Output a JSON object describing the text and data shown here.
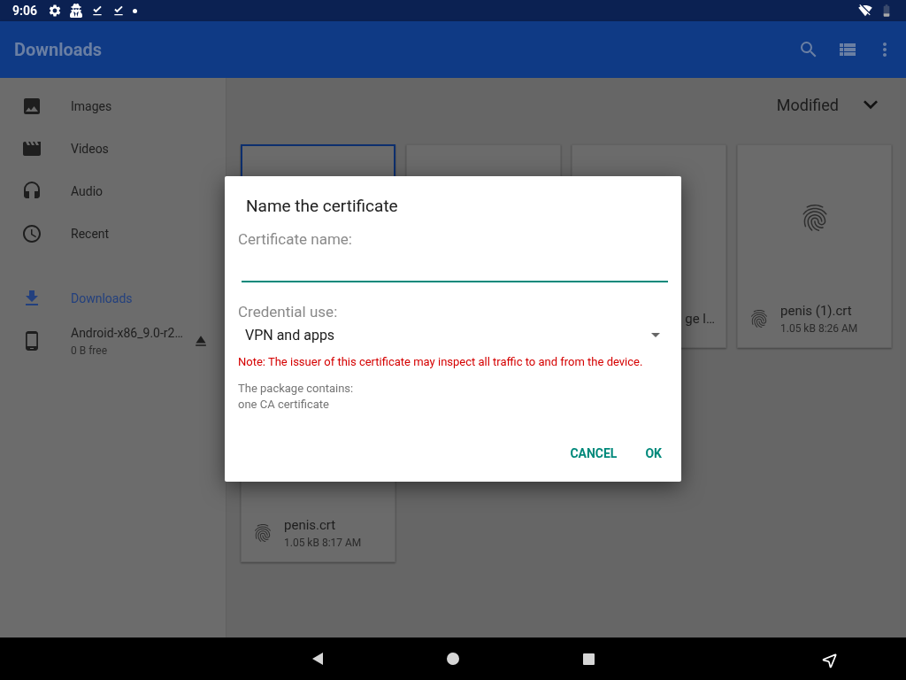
{
  "status_bar": {
    "time": "9:06"
  },
  "app_bar": {
    "title": "Downloads"
  },
  "sidebar": {
    "items": [
      {
        "label": "Images",
        "kind": "images",
        "selected": false
      },
      {
        "label": "Videos",
        "kind": "videos",
        "selected": false
      },
      {
        "label": "Audio",
        "kind": "audio",
        "selected": false
      },
      {
        "label": "Recent",
        "kind": "recent",
        "selected": false
      },
      {
        "label": "Downloads",
        "kind": "downloads",
        "selected": true
      },
      {
        "label": "Android-x86_9.0-r2…",
        "subtitle": "0 B free",
        "kind": "device",
        "selected": false
      }
    ]
  },
  "sort": {
    "label": "Modified"
  },
  "files": [
    {
      "selected": true
    },
    {
      "selected": false
    },
    {
      "name": "ge l…",
      "selected": false
    },
    {
      "name": "penis (1).crt",
      "meta": "1.05 kB 8:26 AM",
      "thumbnail": true,
      "selected": false
    },
    {
      "name": "penis.crt",
      "meta": "1.05 kB 8:17 AM",
      "selected": false
    }
  ],
  "dialog": {
    "title": "Name the certificate",
    "name_label": "Certificate name:",
    "use_label": "Credential use:",
    "use_value": "VPN and apps",
    "note": "Note: The issuer of this certificate may inspect all traffic to and from the device.",
    "package_lines": [
      "The package contains:",
      "one CA certificate"
    ],
    "buttons": [
      "CANCEL",
      "OK"
    ]
  }
}
